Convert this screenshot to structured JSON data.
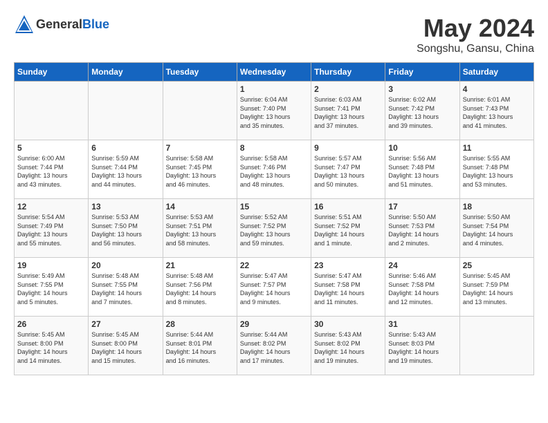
{
  "header": {
    "logo_general": "General",
    "logo_blue": "Blue",
    "month": "May 2024",
    "location": "Songshu, Gansu, China"
  },
  "calendar": {
    "weekdays": [
      "Sunday",
      "Monday",
      "Tuesday",
      "Wednesday",
      "Thursday",
      "Friday",
      "Saturday"
    ],
    "weeks": [
      [
        {
          "day": "",
          "info": ""
        },
        {
          "day": "",
          "info": ""
        },
        {
          "day": "",
          "info": ""
        },
        {
          "day": "1",
          "info": "Sunrise: 6:04 AM\nSunset: 7:40 PM\nDaylight: 13 hours\nand 35 minutes."
        },
        {
          "day": "2",
          "info": "Sunrise: 6:03 AM\nSunset: 7:41 PM\nDaylight: 13 hours\nand 37 minutes."
        },
        {
          "day": "3",
          "info": "Sunrise: 6:02 AM\nSunset: 7:42 PM\nDaylight: 13 hours\nand 39 minutes."
        },
        {
          "day": "4",
          "info": "Sunrise: 6:01 AM\nSunset: 7:43 PM\nDaylight: 13 hours\nand 41 minutes."
        }
      ],
      [
        {
          "day": "5",
          "info": "Sunrise: 6:00 AM\nSunset: 7:44 PM\nDaylight: 13 hours\nand 43 minutes."
        },
        {
          "day": "6",
          "info": "Sunrise: 5:59 AM\nSunset: 7:44 PM\nDaylight: 13 hours\nand 44 minutes."
        },
        {
          "day": "7",
          "info": "Sunrise: 5:58 AM\nSunset: 7:45 PM\nDaylight: 13 hours\nand 46 minutes."
        },
        {
          "day": "8",
          "info": "Sunrise: 5:58 AM\nSunset: 7:46 PM\nDaylight: 13 hours\nand 48 minutes."
        },
        {
          "day": "9",
          "info": "Sunrise: 5:57 AM\nSunset: 7:47 PM\nDaylight: 13 hours\nand 50 minutes."
        },
        {
          "day": "10",
          "info": "Sunrise: 5:56 AM\nSunset: 7:48 PM\nDaylight: 13 hours\nand 51 minutes."
        },
        {
          "day": "11",
          "info": "Sunrise: 5:55 AM\nSunset: 7:48 PM\nDaylight: 13 hours\nand 53 minutes."
        }
      ],
      [
        {
          "day": "12",
          "info": "Sunrise: 5:54 AM\nSunset: 7:49 PM\nDaylight: 13 hours\nand 55 minutes."
        },
        {
          "day": "13",
          "info": "Sunrise: 5:53 AM\nSunset: 7:50 PM\nDaylight: 13 hours\nand 56 minutes."
        },
        {
          "day": "14",
          "info": "Sunrise: 5:53 AM\nSunset: 7:51 PM\nDaylight: 13 hours\nand 58 minutes."
        },
        {
          "day": "15",
          "info": "Sunrise: 5:52 AM\nSunset: 7:52 PM\nDaylight: 13 hours\nand 59 minutes."
        },
        {
          "day": "16",
          "info": "Sunrise: 5:51 AM\nSunset: 7:52 PM\nDaylight: 14 hours\nand 1 minute."
        },
        {
          "day": "17",
          "info": "Sunrise: 5:50 AM\nSunset: 7:53 PM\nDaylight: 14 hours\nand 2 minutes."
        },
        {
          "day": "18",
          "info": "Sunrise: 5:50 AM\nSunset: 7:54 PM\nDaylight: 14 hours\nand 4 minutes."
        }
      ],
      [
        {
          "day": "19",
          "info": "Sunrise: 5:49 AM\nSunset: 7:55 PM\nDaylight: 14 hours\nand 5 minutes."
        },
        {
          "day": "20",
          "info": "Sunrise: 5:48 AM\nSunset: 7:55 PM\nDaylight: 14 hours\nand 7 minutes."
        },
        {
          "day": "21",
          "info": "Sunrise: 5:48 AM\nSunset: 7:56 PM\nDaylight: 14 hours\nand 8 minutes."
        },
        {
          "day": "22",
          "info": "Sunrise: 5:47 AM\nSunset: 7:57 PM\nDaylight: 14 hours\nand 9 minutes."
        },
        {
          "day": "23",
          "info": "Sunrise: 5:47 AM\nSunset: 7:58 PM\nDaylight: 14 hours\nand 11 minutes."
        },
        {
          "day": "24",
          "info": "Sunrise: 5:46 AM\nSunset: 7:58 PM\nDaylight: 14 hours\nand 12 minutes."
        },
        {
          "day": "25",
          "info": "Sunrise: 5:45 AM\nSunset: 7:59 PM\nDaylight: 14 hours\nand 13 minutes."
        }
      ],
      [
        {
          "day": "26",
          "info": "Sunrise: 5:45 AM\nSunset: 8:00 PM\nDaylight: 14 hours\nand 14 minutes."
        },
        {
          "day": "27",
          "info": "Sunrise: 5:45 AM\nSunset: 8:00 PM\nDaylight: 14 hours\nand 15 minutes."
        },
        {
          "day": "28",
          "info": "Sunrise: 5:44 AM\nSunset: 8:01 PM\nDaylight: 14 hours\nand 16 minutes."
        },
        {
          "day": "29",
          "info": "Sunrise: 5:44 AM\nSunset: 8:02 PM\nDaylight: 14 hours\nand 17 minutes."
        },
        {
          "day": "30",
          "info": "Sunrise: 5:43 AM\nSunset: 8:02 PM\nDaylight: 14 hours\nand 19 minutes."
        },
        {
          "day": "31",
          "info": "Sunrise: 5:43 AM\nSunset: 8:03 PM\nDaylight: 14 hours\nand 19 minutes."
        },
        {
          "day": "",
          "info": ""
        }
      ]
    ]
  }
}
